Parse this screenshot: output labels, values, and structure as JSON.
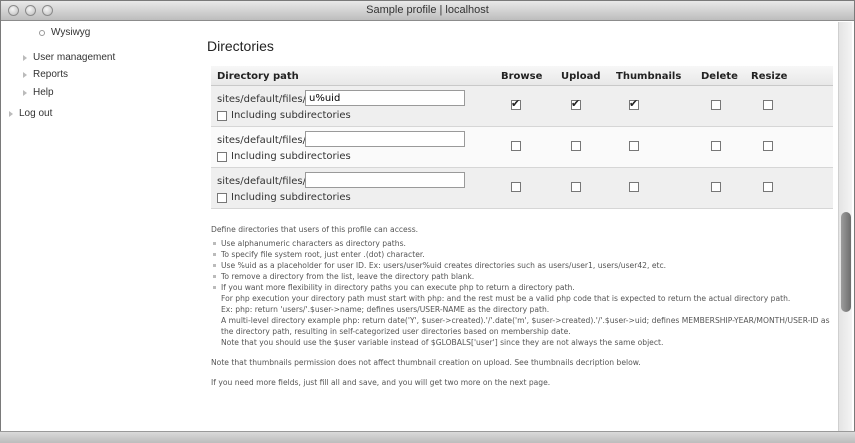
{
  "window": {
    "title": "Sample profile | localhost"
  },
  "sidebar": {
    "items": [
      {
        "label": "Wysiwyg"
      },
      {
        "label": "User management"
      },
      {
        "label": "Reports"
      },
      {
        "label": "Help"
      },
      {
        "label": "Log out"
      }
    ]
  },
  "main": {
    "heading": "Directories",
    "columns": [
      "Directory path",
      "Browse",
      "Upload",
      "Thumbnails",
      "Delete",
      "Resize"
    ],
    "rows": [
      {
        "prefix": "sites/default/files/",
        "value": "u%uid",
        "subdir_label": "Including subdirectories",
        "browse": true,
        "upload": true,
        "thumbnails": true,
        "delete": false,
        "resize": false
      },
      {
        "prefix": "sites/default/files/",
        "value": "",
        "subdir_label": "Including subdirectories",
        "browse": false,
        "upload": false,
        "thumbnails": false,
        "delete": false,
        "resize": false
      },
      {
        "prefix": "sites/default/files/",
        "value": "",
        "subdir_label": "Including subdirectories",
        "browse": false,
        "upload": false,
        "thumbnails": false,
        "delete": false,
        "resize": false
      }
    ],
    "help": {
      "intro": "Define directories that users of this profile can access.",
      "bullets": [
        "Use alphanumeric characters as directory paths.",
        "To specify file system root, just enter .(dot) character.",
        "Use %uid as a placeholder for user ID. Ex: users/user%uid creates directories such as users/user1, users/user42, etc.",
        "To remove a directory from the list, leave the directory path blank.",
        "If you want more flexibility in directory paths you can execute php to return a directory path."
      ],
      "php_lines": [
        "For php execution your directory path must start with php: and the rest must be a valid php code that is expected to return the actual directory path.",
        "Ex: php: return 'users/'.$user->name; defines users/USER-NAME as the directory path.",
        "A multi-level directory example php: return date('Y', $user->created).'/'.date('m', $user->created).'/'.$user->uid; defines MEMBERSHIP-YEAR/MONTH/USER-ID as the directory path, resulting in self-categorized user directories based on membership date.",
        "Note that you should use the $user variable instead of $GLOBALS['user'] since they are not always the same object."
      ],
      "note1": "Note that thumbnails permission does not affect thumbnail creation on upload. See thumbnails decription below.",
      "note2": "If you need more fields, just fill all and save, and you will get two more on the next page."
    }
  }
}
